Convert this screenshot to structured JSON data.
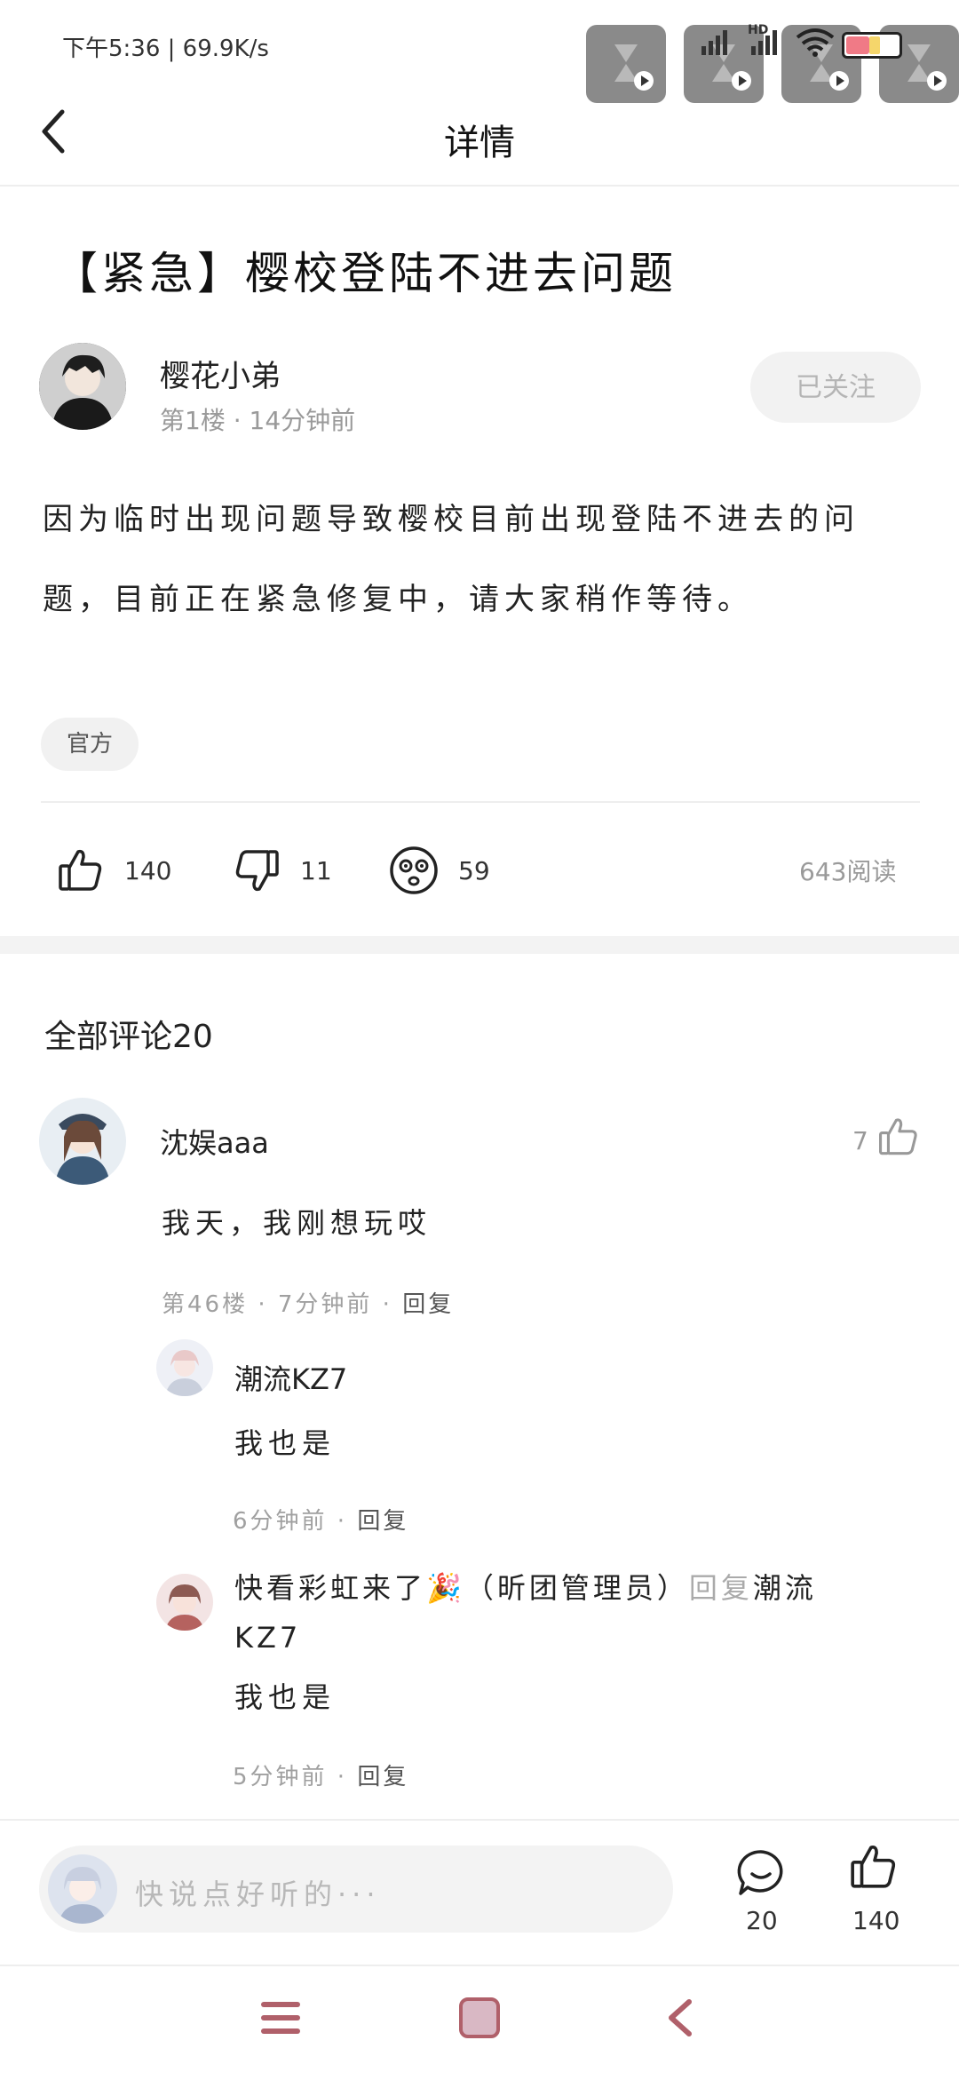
{
  "status_bar": {
    "time": "下午5:36 | 69.9K/s",
    "network_label": "HD",
    "accent_color": "#e7a9b3"
  },
  "header": {
    "back_icon": "chevron-left-icon",
    "title": "详情"
  },
  "post": {
    "title": "【紧急】樱校登陆不进去问题",
    "author": {
      "name": "樱花小弟",
      "meta": "第1楼 · 14分钟前"
    },
    "follow_label": "已关注",
    "body": "因为临时出现问题导致樱校目前出现登陆不进去的问题，目前正在紧急修复中，请大家稍作等待。",
    "tag": "官方",
    "reactions": {
      "likes": "140",
      "dislikes": "11",
      "dizzy": "59"
    },
    "read_count": "643阅读"
  },
  "comments": {
    "title": "全部评论20",
    "items": [
      {
        "name": "沈娱aaa",
        "text": "我天，我刚想玩哎",
        "meta_prefix": "第46楼 · 7分钟前 · ",
        "reply_label": "回复",
        "likes": "7",
        "replies": [
          {
            "name": "潮流KZ7",
            "text": "我也是",
            "meta_prefix": "6分钟前 · ",
            "reply_label": "回复"
          },
          {
            "name": "快看彩虹来了🎉（昕团管理员）",
            "reply_word": "回复",
            "reply_target": "潮流KZ7",
            "text": "我也是",
            "meta_prefix": "5分钟前 · ",
            "reply_label": "回复"
          }
        ]
      }
    ]
  },
  "bottom_bar": {
    "input_placeholder": "快说点好听的···",
    "comment_count": "20",
    "like_count": "140"
  },
  "navbar": {
    "menu_icon": "menu-icon",
    "home_icon": "home-square-icon",
    "back_icon": "back-icon",
    "color": "#b0606a"
  }
}
